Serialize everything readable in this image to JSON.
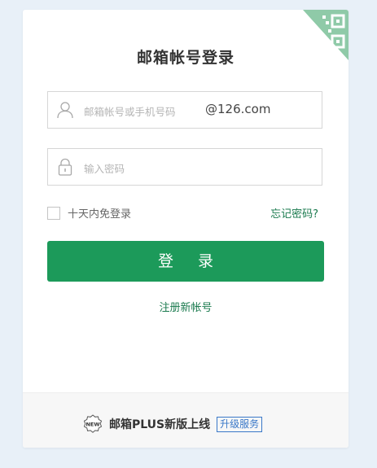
{
  "login": {
    "title": "邮箱帐号登录",
    "account_placeholder": "邮箱帐号或手机号码",
    "account_suffix": "@126.com",
    "password_placeholder": "输入密码",
    "remember_label": "十天内免登录",
    "forgot_label": "忘记密码?",
    "login_button": "登 录",
    "register_link": "注册新帐号"
  },
  "footer": {
    "badge_text": "NEW",
    "promo_text": "邮箱PLUS新版上线",
    "upgrade_label": "升级服务"
  },
  "colors": {
    "accent": "#1c9a5a",
    "link": "#1a7a4e",
    "upgrade": "#3a78c8",
    "page_bg": "#e8f0f8"
  },
  "icons": {
    "qr": "qr-code-icon",
    "user": "user-icon",
    "lock": "lock-icon",
    "new": "new-badge-icon"
  }
}
